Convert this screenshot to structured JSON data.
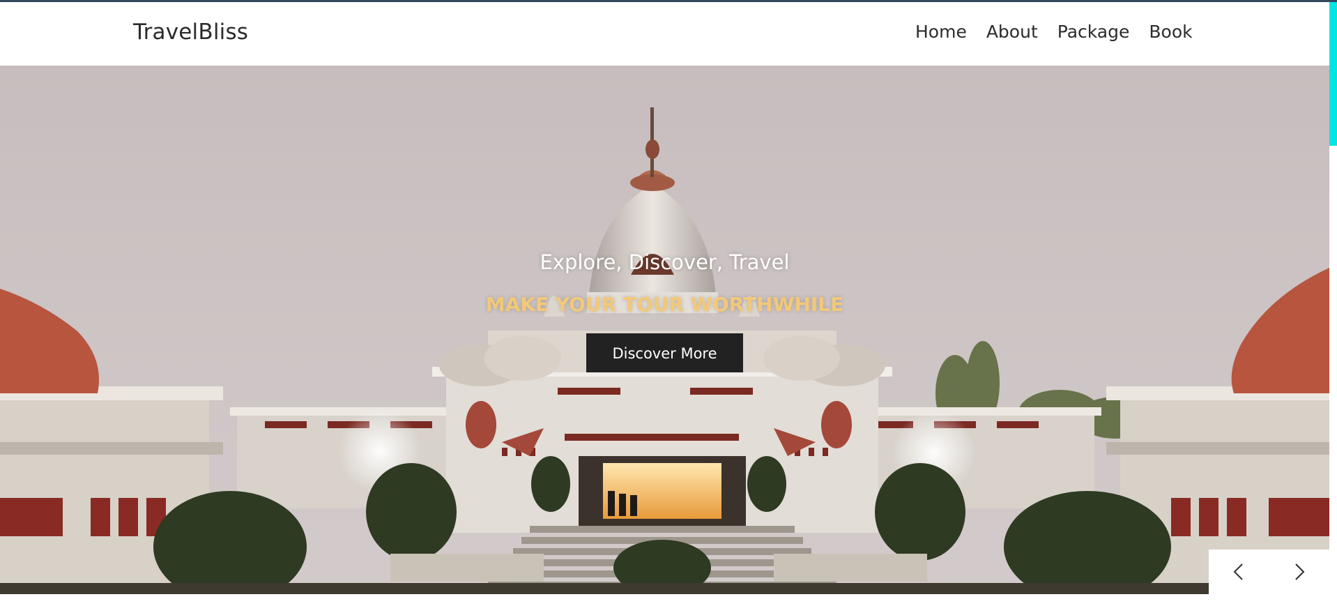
{
  "brand": {
    "name": "TravelBliss"
  },
  "nav": {
    "items": [
      {
        "label": "Home"
      },
      {
        "label": "About"
      },
      {
        "label": "Package"
      },
      {
        "label": "Book"
      }
    ]
  },
  "hero": {
    "subtitle": "Explore, Discover, Travel",
    "title": "MAKE YOUR TOUR WORTHWHILE",
    "cta_label": "Discover More",
    "image_icon": "temple-photo"
  },
  "carousel": {
    "prev_icon": "chevron-left-icon",
    "next_icon": "chevron-right-icon"
  },
  "colors": {
    "accent_title": "#f2c97a",
    "button_bg": "#222222",
    "scroll_thumb": "#00e5e5",
    "top_strip": "#34495e"
  }
}
